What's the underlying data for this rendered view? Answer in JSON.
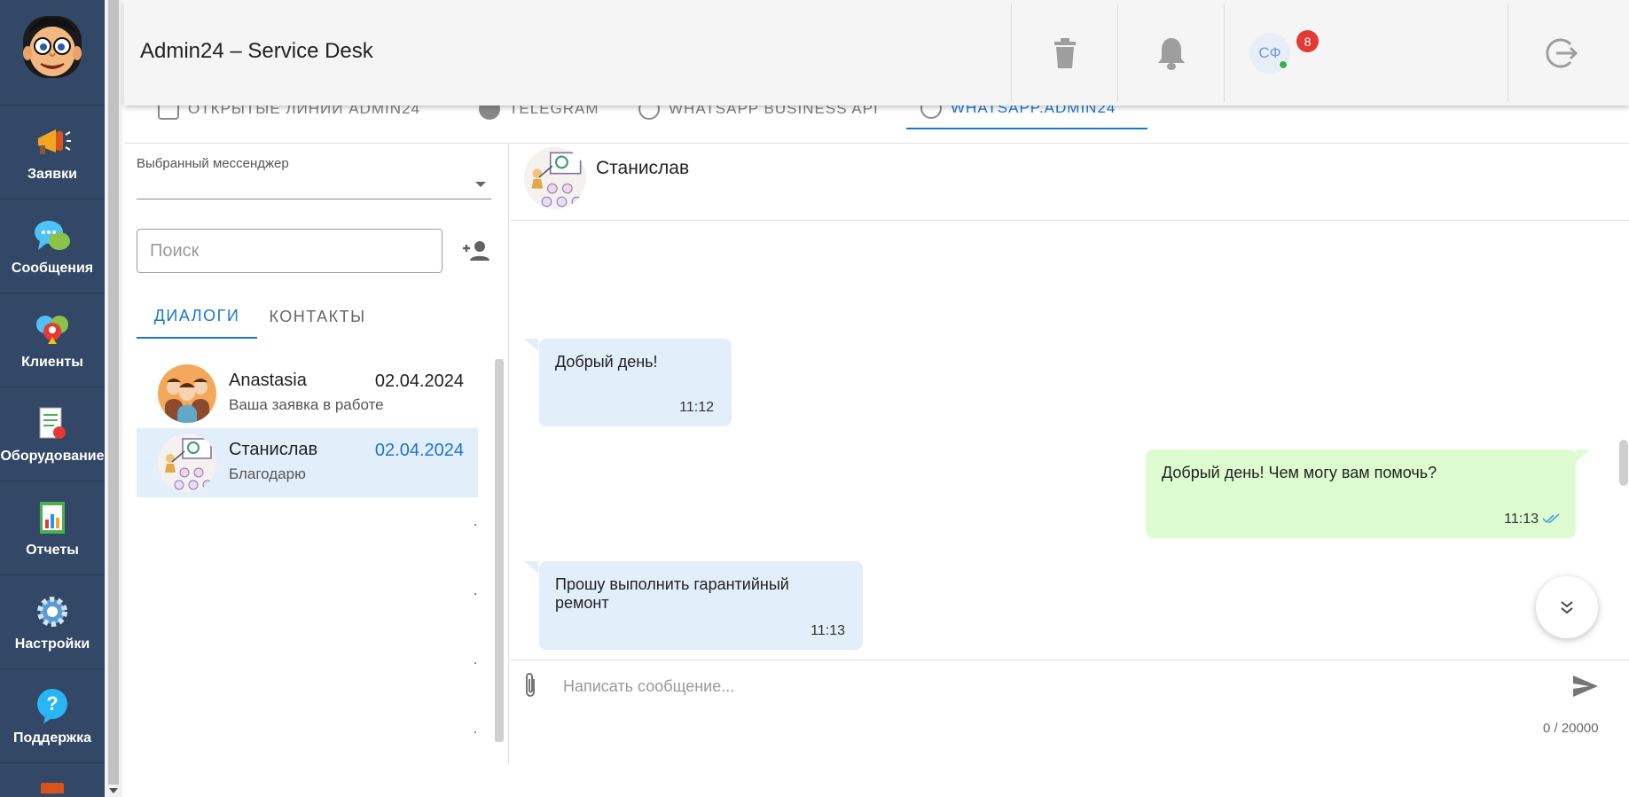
{
  "app": {
    "title": "Admin24 – Service Desk"
  },
  "header": {
    "notifications_count": "8",
    "user_initials": "СФ"
  },
  "sidebar": {
    "items": [
      {
        "label": "Заявки",
        "icon": "megaphone-icon"
      },
      {
        "label": "Сообщения",
        "icon": "chat-bubbles-icon"
      },
      {
        "label": "Клиенты",
        "icon": "clients-icon"
      },
      {
        "label": "Оборудование",
        "icon": "equipment-icon"
      },
      {
        "label": "Отчеты",
        "icon": "reports-icon"
      },
      {
        "label": "Настройки",
        "icon": "gear-icon"
      },
      {
        "label": "Поддержка",
        "icon": "help-icon"
      }
    ]
  },
  "channel_tabs": [
    {
      "label": "ОТКРЫТЫЕ ЛИНИИ ADMIN24"
    },
    {
      "label": "TELEGRAM"
    },
    {
      "label": "WHATSAPP BUSINESS API"
    },
    {
      "label": "WHATSAPP.ADMIN24"
    }
  ],
  "left": {
    "messenger_label": "Выбранный мессенджер",
    "search_placeholder": "Поиск",
    "tabs": [
      {
        "label": "ДИАЛОГИ",
        "active": true
      },
      {
        "label": "КОНТАКТЫ",
        "active": false
      }
    ],
    "dialogs": [
      {
        "name": "Anastasia",
        "last_message": "Ваша заявка в работе",
        "date": "02.04.2024",
        "selected": false
      },
      {
        "name": "Станислав",
        "last_message": "Благодарю",
        "date": "02.04.2024",
        "selected": true
      }
    ]
  },
  "chat": {
    "contact_name": "Станислав",
    "messages": [
      {
        "direction": "in",
        "text": "Добрый день!",
        "time": "11:12"
      },
      {
        "direction": "out",
        "text": "Добрый день! Чем могу вам помочь?",
        "time": "11:13",
        "status": "read"
      },
      {
        "direction": "in",
        "text": "Прошу выполнить гарантийный ремонт",
        "time": "11:13"
      }
    ],
    "composer_placeholder": "Написать сообщение...",
    "char_counter": "0 / 20000"
  },
  "colors": {
    "sidebar_bg": "#334866",
    "accent": "#1976d2",
    "incoming_bubble": "#e3eefb",
    "outgoing_bubble": "#ddfcd0",
    "badge": "#e53935"
  }
}
